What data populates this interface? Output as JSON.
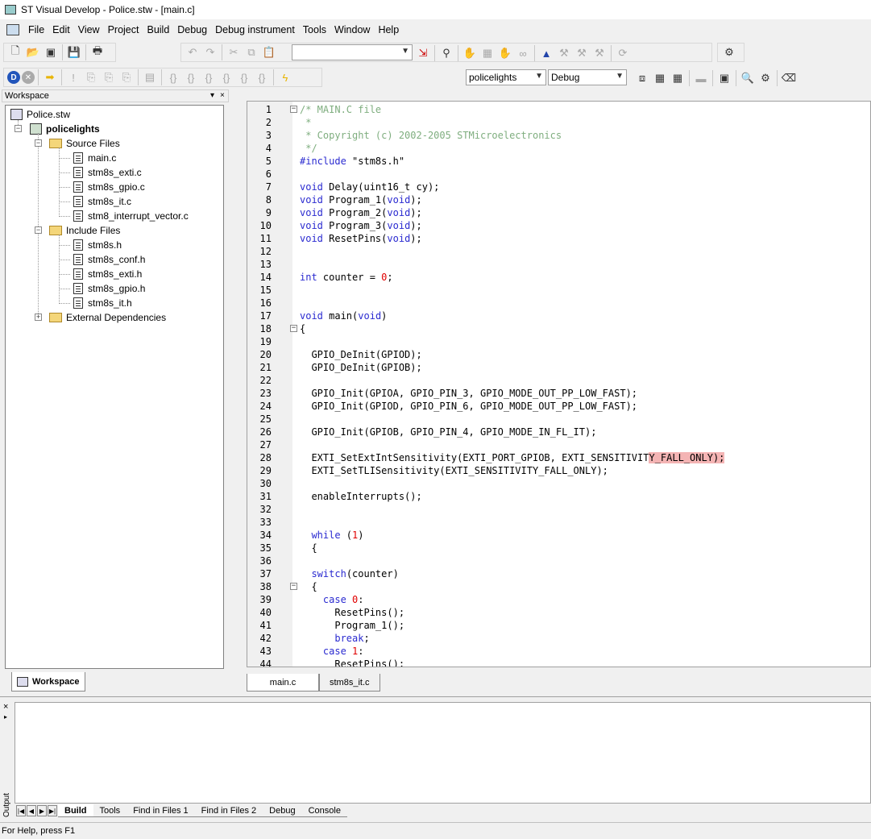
{
  "window": {
    "title": "ST Visual Develop - Police.stw - [main.c]"
  },
  "menu": [
    "File",
    "Edit",
    "View",
    "Project",
    "Build",
    "Debug",
    "Debug instrument",
    "Tools",
    "Window",
    "Help"
  ],
  "toolbar": {
    "find_combo_value": "",
    "project_combo_value": "policelights",
    "config_combo_value": "Debug"
  },
  "workspace": {
    "header": "Workspace",
    "tab_label": "Workspace",
    "tree": {
      "root": "Police.stw",
      "project": "policelights",
      "source_folder": "Source Files",
      "source_files": [
        "main.c",
        "stm8s_exti.c",
        "stm8s_gpio.c",
        "stm8s_it.c",
        "stm8_interrupt_vector.c"
      ],
      "include_folder": "Include Files",
      "include_files": [
        "stm8s.h",
        "stm8s_conf.h",
        "stm8s_exti.h",
        "stm8s_gpio.h",
        "stm8s_it.h"
      ],
      "external_folder": "External Dependencies"
    }
  },
  "editor": {
    "tabs": [
      "main.c",
      "stm8s_it.c"
    ],
    "active_tab": "main.c",
    "lines": [
      "/* MAIN.C file",
      " *",
      " * Copyright (c) 2002-2005 STMicroelectronics",
      " */",
      "#include \"stm8s.h\"",
      "",
      "void Delay(uint16_t cy);",
      "void Program_1(void);",
      "void Program_2(void);",
      "void Program_3(void);",
      "void ResetPins(void);",
      "",
      "",
      "int counter = 0;",
      "",
      "",
      "void main(void)",
      "{",
      "",
      "  GPIO_DeInit(GPIOD);",
      "  GPIO_DeInit(GPIOB);",
      "",
      "  GPIO_Init(GPIOA, GPIO_PIN_3, GPIO_MODE_OUT_PP_LOW_FAST);",
      "  GPIO_Init(GPIOD, GPIO_PIN_6, GPIO_MODE_OUT_PP_LOW_FAST);",
      "",
      "  GPIO_Init(GPIOB, GPIO_PIN_4, GPIO_MODE_IN_FL_IT);",
      "",
      "  EXTI_SetExtIntSensitivity(EXTI_PORT_GPIOB, EXTI_SENSITIVITY_FALL_ONLY);",
      "  EXTI_SetTLISensitivity(EXTI_SENSITIVITY_FALL_ONLY);",
      "",
      "  enableInterrupts();",
      "",
      "",
      "  while (1)",
      "  {",
      "",
      "  switch(counter)",
      "  {",
      "    case 0:",
      "      ResetPins();",
      "      Program_1();",
      "      break;",
      "    case 1:",
      "      ResetPins();"
    ]
  },
  "output": {
    "side_label": "Output",
    "tabs": [
      "Build",
      "Tools",
      "Find in Files 1",
      "Find in Files 2",
      "Debug",
      "Console"
    ],
    "active_tab": "Build"
  },
  "status": {
    "text": "For Help, press F1"
  }
}
